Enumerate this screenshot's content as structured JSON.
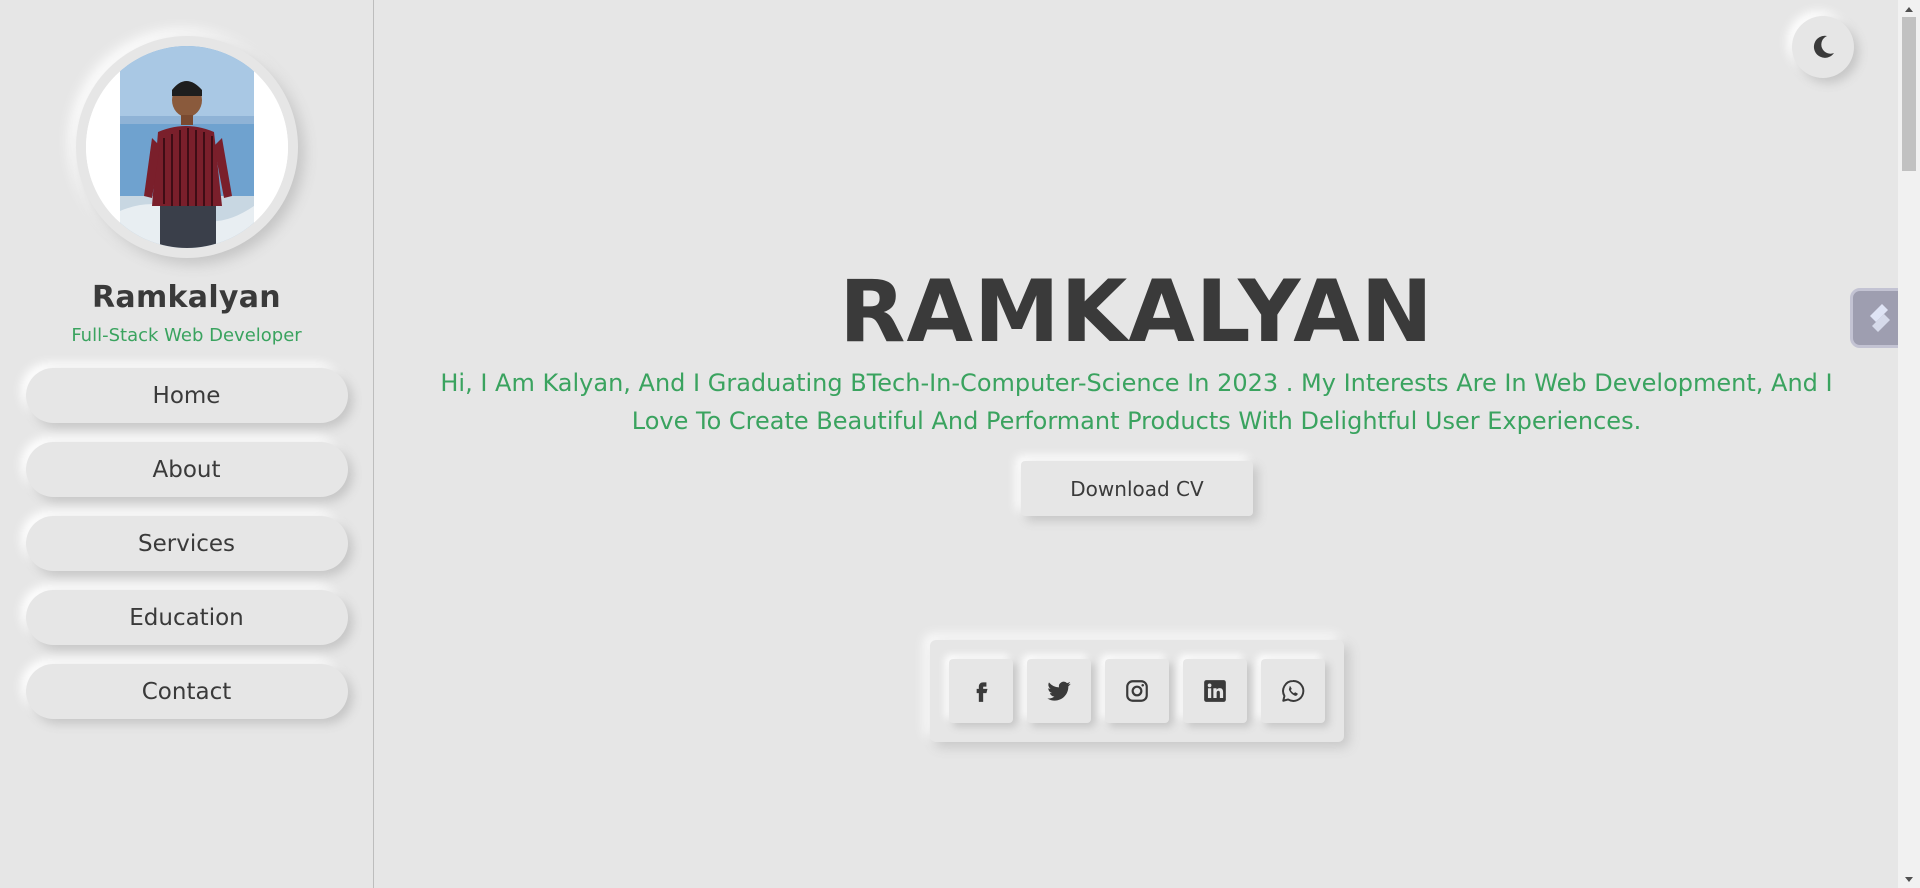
{
  "sidebar": {
    "profile": {
      "name": "Ramkalyan",
      "role": "Full-Stack Web Developer"
    },
    "nav": [
      {
        "label": "Home"
      },
      {
        "label": "About"
      },
      {
        "label": "Services"
      },
      {
        "label": "Education"
      },
      {
        "label": "Contact"
      }
    ]
  },
  "header": {
    "theme_toggle_icon": "moon-icon"
  },
  "hero": {
    "title": "RAMKALYAN",
    "subtitle": "Hi, I Am Kalyan, And I Graduating BTech-In-Computer-Science In 2023 . My Interests Are In Web Development, And I Love To Create Beautiful And Performant Products With Delightful User Experiences.",
    "cta_label": "Download CV"
  },
  "social": {
    "icons": [
      "facebook-icon",
      "twitter-icon",
      "instagram-icon",
      "linkedin-icon",
      "whatsapp-icon"
    ]
  },
  "floating_widget": {
    "icon": "extension-icon"
  },
  "colors": {
    "background": "#e6e6e6",
    "text": "#3a3a3a",
    "accent": "#3aa35f"
  }
}
